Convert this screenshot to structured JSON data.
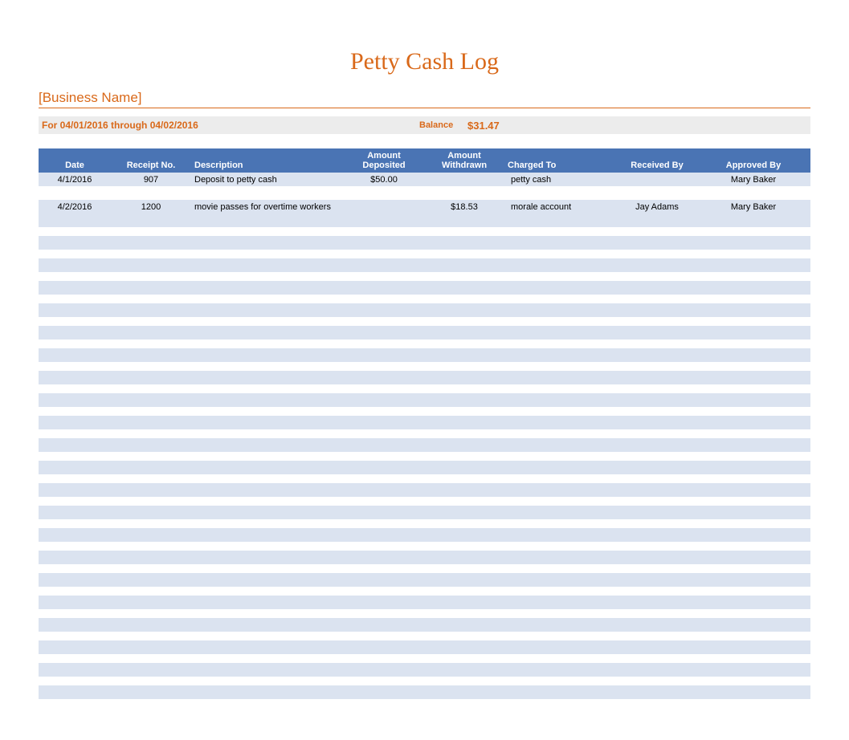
{
  "title": "Petty Cash Log",
  "business_name": "[Business Name]",
  "period_text": "For 04/01/2016 through 04/02/2016",
  "balance_label": "Balance",
  "balance_value": "$31.47",
  "headers": {
    "date": "Date",
    "receipt": "Receipt No.",
    "description": "Description",
    "deposited_l1": "Amount",
    "deposited_l2": "Deposited",
    "withdrawn_l1": "Amount",
    "withdrawn_l2": "Withdrawn",
    "charged": "Charged To",
    "received": "Received By",
    "approved": "Approved By"
  },
  "rows": [
    {
      "date": "4/1/2016",
      "receipt": "907",
      "description": "Deposit to petty cash",
      "deposited": "$50.00",
      "withdrawn": "",
      "charged": "petty cash",
      "received": "",
      "approved": "Mary Baker"
    },
    {
      "date": "4/2/2016",
      "receipt": "1200",
      "description": "movie passes for overtime workers",
      "deposited": "",
      "withdrawn": "$18.53",
      "charged": "morale account",
      "received": "Jay Adams",
      "approved": "Mary Baker"
    }
  ],
  "empty_row_count": 22
}
